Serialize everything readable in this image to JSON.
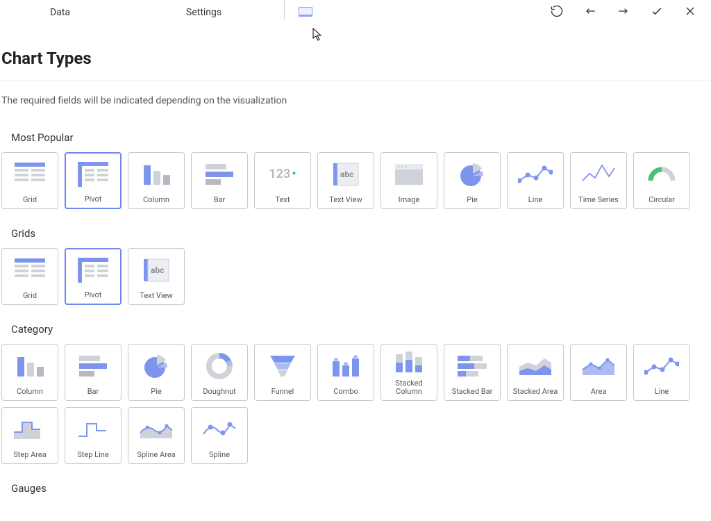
{
  "topbar": {
    "tab_data": "Data",
    "tab_settings": "Settings"
  },
  "page": {
    "title": "Chart Types",
    "subtitle": "The required fields will be indicated depending on the visualization"
  },
  "sections": {
    "popular": "Most Popular",
    "grids": "Grids",
    "category": "Category",
    "gauges": "Gauges"
  },
  "labels": {
    "grid": "Grid",
    "pivot": "Pivot",
    "column": "Column",
    "bar": "Bar",
    "text": "Text",
    "textview": "Text View",
    "image": "Image",
    "pie": "Pie",
    "line": "Line",
    "timeseries": "Time Series",
    "circular": "Circular",
    "doughnut": "Doughnut",
    "funnel": "Funnel",
    "combo": "Combo",
    "stackedcolumn": "Stacked Column",
    "stackedbar": "Stacked Bar",
    "stackedarea": "Stacked Area",
    "area": "Area",
    "steparea": "Step Area",
    "stepline": "Step Line",
    "splinearea": "Spline Area",
    "spline": "Spline"
  },
  "glyphs": {
    "textnum": "123",
    "abc": "abc"
  }
}
